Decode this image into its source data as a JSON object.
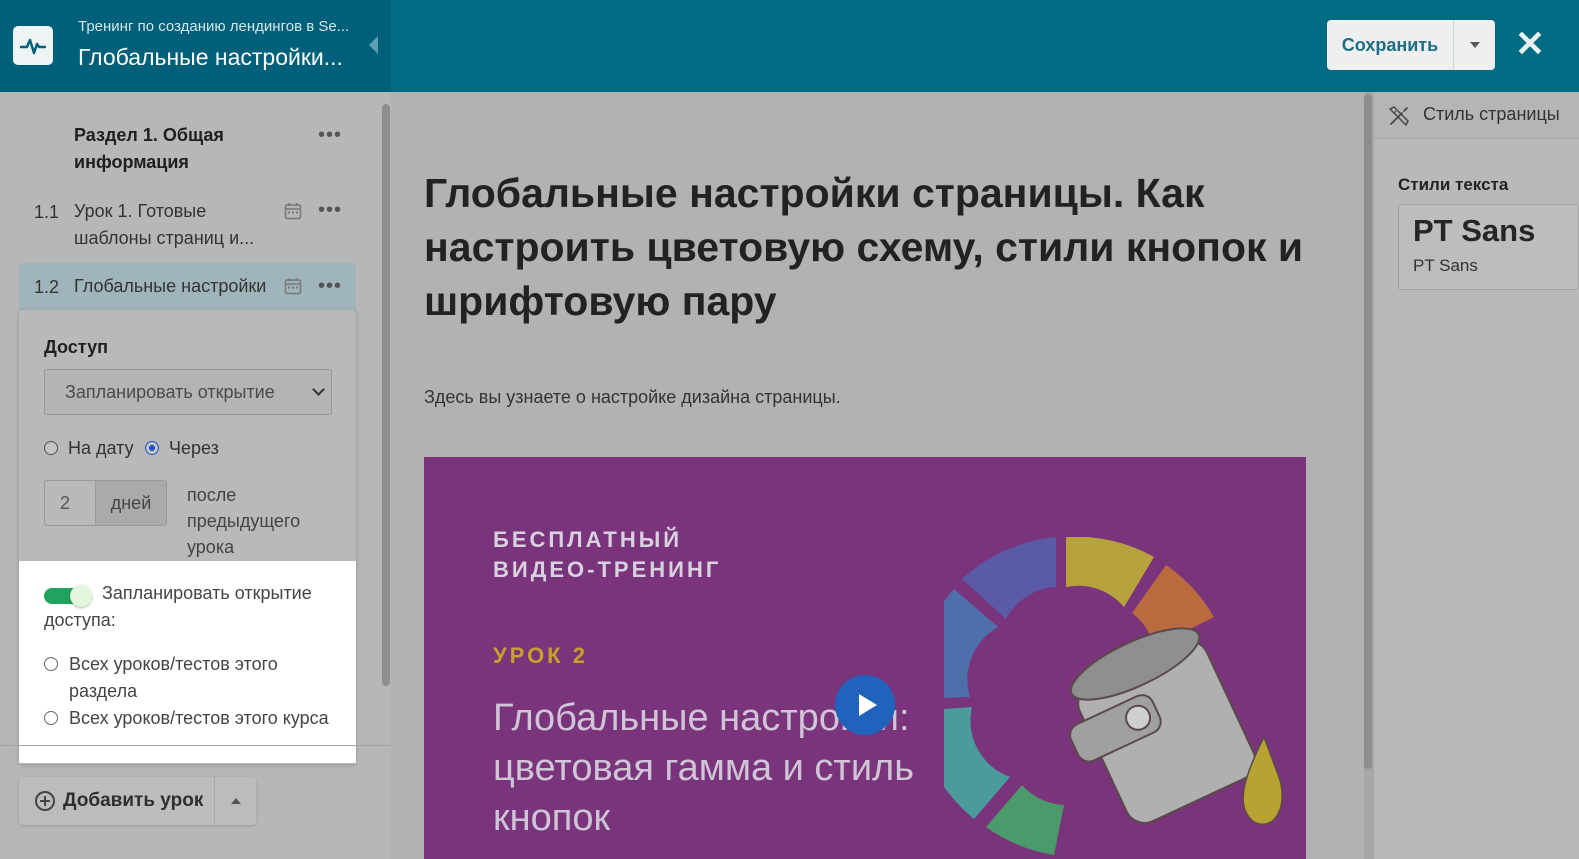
{
  "header": {
    "subtitle": "Тренинг по созданию лендингов в Se...",
    "title": "Глобальные настройки...",
    "save_label": "Сохранить",
    "close_glyph": "✕"
  },
  "sidebar": {
    "section_title": "Раздел 1. Общая информация",
    "lessons": [
      {
        "num": "1.1",
        "text": "Урок 1. Готовые шаблоны страниц и..."
      },
      {
        "num": "1.2",
        "text": "Глобальные настройки"
      }
    ],
    "menu_glyph": "•••",
    "access": {
      "label": "Доступ",
      "select_value": "Запланировать открытие",
      "radio_date": "На дату",
      "radio_after": "Через",
      "days_value": "2",
      "days_unit": "дней",
      "after_text": "после предыдущего урока",
      "toggle_label": "Запланировать открытие доступа:",
      "option_section": "Всех уроков/тестов этого раздела",
      "option_course": "Всех уроков/тестов этого курса"
    },
    "add_lesson_label": "Добавить урок"
  },
  "main": {
    "title": "Глобальные настройки страницы. Как настроить цветовую схему, стили кнопок и шрифтовую пару",
    "description": "Здесь вы узнаете о настройке дизайна страницы.",
    "video": {
      "badge_line1": "БЕСПЛАТНЫЙ",
      "badge_line2": "ВИДЕО-ТРЕНИНГ",
      "lesson": "УРОК 2",
      "title": "Глобальные настройки: цветовая гамма и стиль кнопок"
    }
  },
  "right_panel": {
    "tab_label": "Стиль страницы",
    "heading": "Стили текста",
    "font_main": "PT Sans",
    "font_sub": "PT Sans"
  },
  "colors": {
    "header": "#006b83",
    "header_left": "#00607a",
    "toggle_on": "#20a35c",
    "play": "#1f63bd",
    "video_bg": "#7a347c"
  }
}
